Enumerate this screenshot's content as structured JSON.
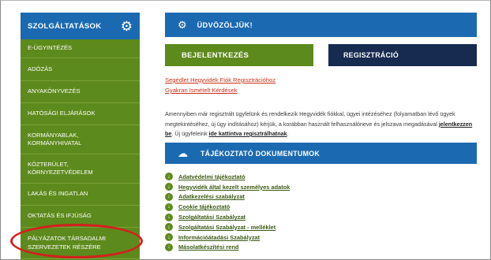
{
  "sidebar": {
    "header": "SZOLGÁLTATÁSOK",
    "header_icon": "gears-icon",
    "items": [
      {
        "label": "E-ÜGYINTÉZÉS"
      },
      {
        "label": "ADÓZÁS"
      },
      {
        "label": "ANYAKÖNYVEZÉS"
      },
      {
        "label": "HATÓSÁGI ELJÁRÁSOK"
      },
      {
        "label": "KORMÁNYABLAK, KORMÁNYHIVATAL"
      },
      {
        "label": "KÖZTERÜLET, KÖRNYEZETVÉDELEM"
      },
      {
        "label": "LAKÁS ÉS INGATLAN"
      },
      {
        "label": "OKTATÁS ÉS IFJÚSÁG"
      },
      {
        "label": "PÁLYÁZATOK TÁRSADALMI SZERVEZETEK RÉSZÉRE"
      }
    ]
  },
  "welcome": {
    "title": "ÜDVÖZÖLJÜK!",
    "icon": "gear-icon"
  },
  "auth": {
    "login": "BEJELENTKEZÉS",
    "register": "REGISZTRÁCIÓ"
  },
  "links": {
    "guide": "Segédlet Hegyvidék Fiók Regisztrációhoz",
    "faq": "Gyakran Ismételt Kérdések"
  },
  "paragraph": {
    "part1": "Amennyiben már regisztrált ügyfelünk és rendelkezik Hegyvidék fiókkal, ügyei intézéséhez (folyamatban lévő ügyek megtekintéséhez, új ügy indításához) kérjük, a korábban használt felhasználóneve és jelszava megadásával ",
    "login_link": "jelentkezzen be",
    "part2": ". Új ügyfeleink ",
    "register_link": "ide kattintva regisztrálhatnak",
    "part3": "."
  },
  "documents": {
    "title": "TÁJÉKOZTATÓ DOKUMENTUMOK",
    "icon": "cloud-download-icon",
    "items": [
      "Adatvédelmi tájékoztató",
      "Hegyvidék által kezelt személyes adatok",
      "Adatkezelési szabályzat",
      "Cookie tájékoztató",
      "Szolgáltatási Szabályzat",
      "Szolgáltatási Szabályzat - melléklet",
      "Információátadási Szabályzat",
      "Másolatkészítési rend"
    ]
  },
  "colors": {
    "blue": "#1b6ab1",
    "green": "#5d8a1c",
    "navy": "#172b50",
    "red": "#d41f1f",
    "link_red": "#c9321a"
  }
}
